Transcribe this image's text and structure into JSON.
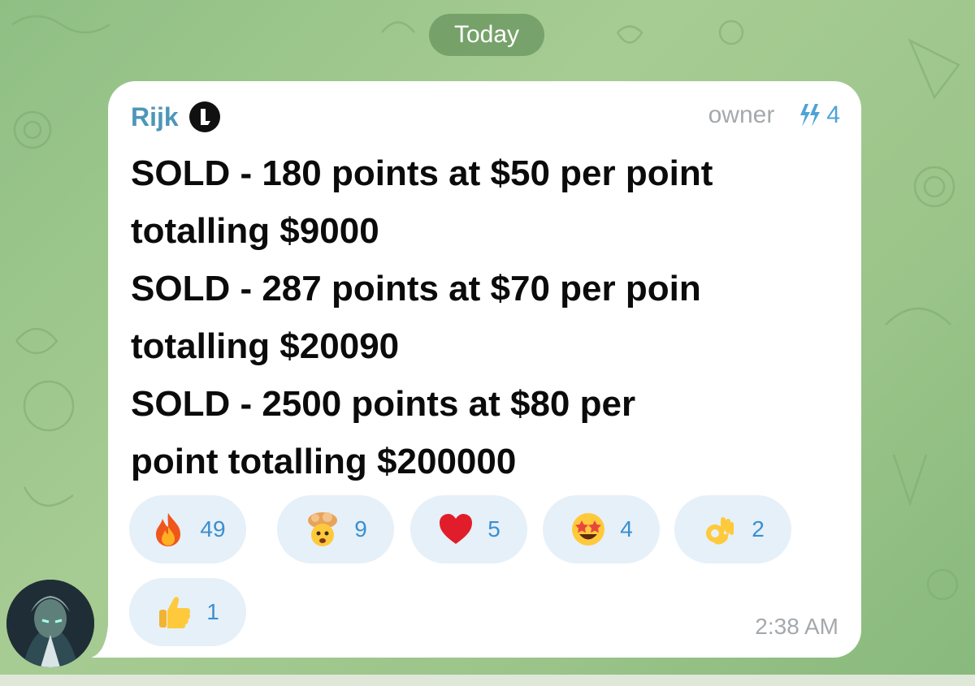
{
  "chat": {
    "date_label": "Today"
  },
  "message": {
    "sender": "Rijk",
    "sender_badge_icon": "logo-badge-icon",
    "role_label": "owner",
    "boost_icon": "boost-lightning-icon",
    "boost_count": "4",
    "lines": [
      "SOLD - 180 points at $50 per point",
      "totalling $9000",
      "SOLD - 287 points at $70 per poin",
      "totalling $20090",
      "SOLD - 2500 points at $80 per",
      "point totalling $200000"
    ],
    "time": "2:38 AM",
    "reactions": [
      {
        "emoji": "fire-icon",
        "count": "49"
      },
      {
        "emoji": "exploding-head-icon",
        "count": "9"
      },
      {
        "emoji": "red-heart-icon",
        "count": "5"
      },
      {
        "emoji": "star-struck-icon",
        "count": "4"
      },
      {
        "emoji": "ok-hand-icon",
        "count": "2"
      },
      {
        "emoji": "thumbs-up-icon",
        "count": "1"
      }
    ]
  },
  "colors": {
    "sender_name": "#4d96b8",
    "reaction_count": "#3a8fd1",
    "reaction_bg": "#e6f0f8",
    "meta_gray": "#a4a9ad",
    "wallpaper": "#9cc58a"
  }
}
